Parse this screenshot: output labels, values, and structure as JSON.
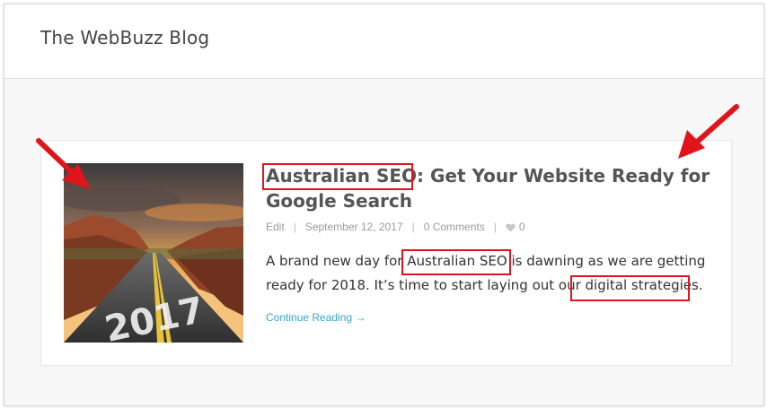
{
  "site": {
    "title": "The WebBuzz Blog"
  },
  "post": {
    "title_part1": "Australian SEO",
    "title_part2": ": Get Your Website Ready for Google Search",
    "meta": {
      "edit_label": "Edit",
      "separator": "|",
      "date": "September 12, 2017",
      "comments": "0 Comments",
      "likes": "0"
    },
    "excerpt": {
      "part1": "A brand new day for ",
      "keyword1": "Australian SEO",
      "part2": " is dawning as we are getting ready for 2018. It’s time to start laying out our ",
      "keyword2": "digital strategies",
      "part3": "."
    },
    "read_more": "Continue Reading →",
    "thumbnail_road_text": "2017"
  },
  "annotations": {
    "highlight_color": "#e0141a"
  }
}
